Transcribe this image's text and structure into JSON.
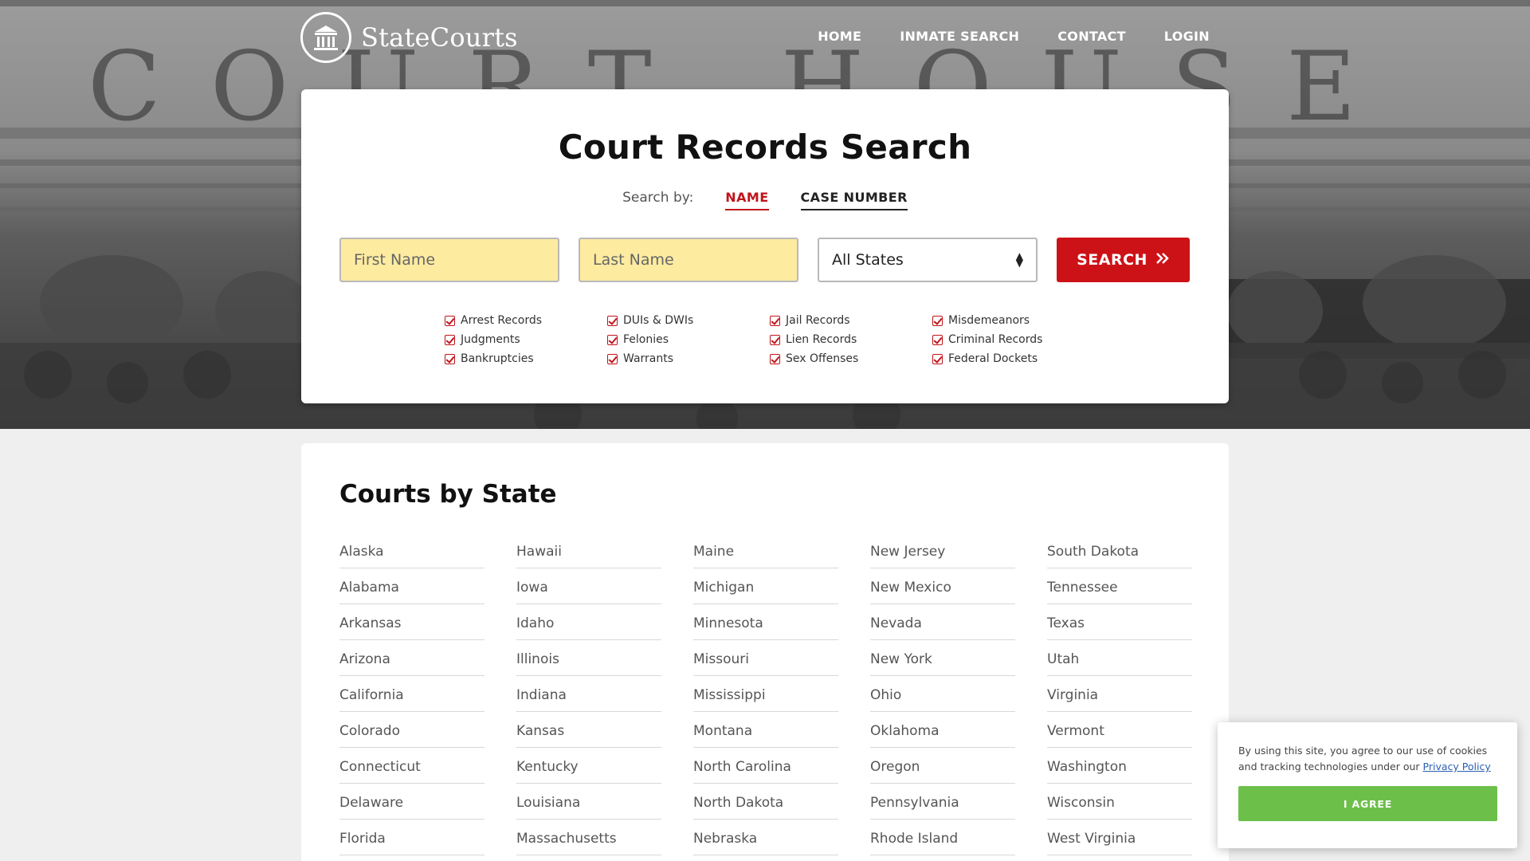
{
  "header": {
    "brand": "StateCourts",
    "nav": [
      "HOME",
      "INMATE SEARCH",
      "CONTACT",
      "LOGIN"
    ]
  },
  "hero": {
    "background_text": "COURT HOUSE"
  },
  "search": {
    "title": "Court Records Search",
    "search_by_label": "Search by:",
    "tabs": [
      "NAME",
      "CASE NUMBER"
    ],
    "active_tab": "NAME",
    "first_name_placeholder": "First Name",
    "last_name_placeholder": "Last Name",
    "state_select_value": "All States",
    "button_label": "SEARCH",
    "features": [
      [
        "Arrest Records",
        "Judgments",
        "Bankruptcies"
      ],
      [
        "DUIs & DWIs",
        "Felonies",
        "Warrants"
      ],
      [
        "Jail Records",
        "Lien Records",
        "Sex Offenses"
      ],
      [
        "Misdemeanors",
        "Criminal Records",
        "Federal Dockets"
      ]
    ]
  },
  "states": {
    "title": "Courts by State",
    "columns": [
      [
        "Alaska",
        "Alabama",
        "Arkansas",
        "Arizona",
        "California",
        "Colorado",
        "Connecticut",
        "Delaware",
        "Florida"
      ],
      [
        "Hawaii",
        "Iowa",
        "Idaho",
        "Illinois",
        "Indiana",
        "Kansas",
        "Kentucky",
        "Louisiana",
        "Massachusetts"
      ],
      [
        "Maine",
        "Michigan",
        "Minnesota",
        "Missouri",
        "Mississippi",
        "Montana",
        "North Carolina",
        "North Dakota",
        "Nebraska"
      ],
      [
        "New Jersey",
        "New Mexico",
        "Nevada",
        "New York",
        "Ohio",
        "Oklahoma",
        "Oregon",
        "Pennsylvania",
        "Rhode Island"
      ],
      [
        "South Dakota",
        "Tennessee",
        "Texas",
        "Utah",
        "Virginia",
        "Vermont",
        "Washington",
        "Wisconsin",
        "West Virginia"
      ]
    ]
  },
  "cookie": {
    "text": "By using this site, you agree to our use of cookies and tracking technologies under our",
    "link": "Privacy Policy",
    "button": "I AGREE"
  },
  "colors": {
    "accent_red": "#cd1217",
    "input_yellow": "#fdeba0",
    "cookie_green": "#6cc04a"
  }
}
